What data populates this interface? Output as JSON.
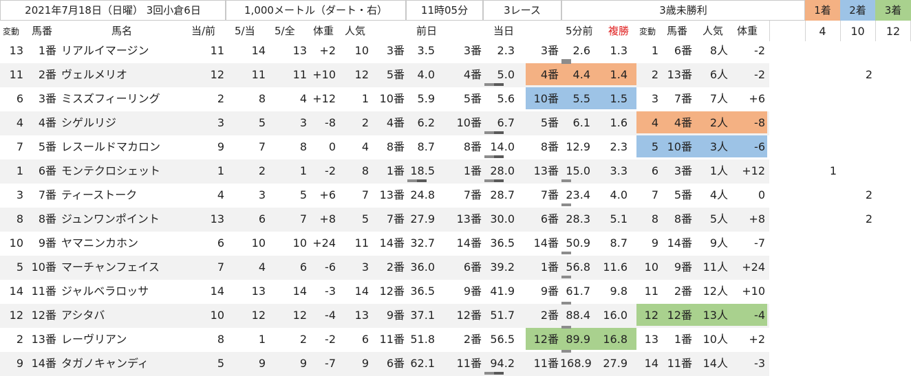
{
  "header": {
    "date": "2021年7月18日（日曜）",
    "meeting": "3回小倉6日",
    "distance": "1,000メートル（ダート・右）",
    "time": "11時05分",
    "race_no": "3レース",
    "race_name": "3歳未勝利",
    "place_labels": [
      "1着",
      "2着",
      "3着"
    ],
    "place_horses": [
      "4",
      "10",
      "12"
    ]
  },
  "columns": {
    "hendo": "変動",
    "umaban": "馬番",
    "bamei": "馬名",
    "ato_mae": "当/前",
    "go_ato": "5/当",
    "go_zen": "5/全",
    "taiju": "体重",
    "ninki": "人気",
    "zenjitsu": "前日",
    "toujitsu": "当日",
    "gofunmae": "5分前",
    "fukusho": "複勝",
    "hendo2": "変動",
    "umaban2": "馬番",
    "ninki2": "人気",
    "taiju2": "体重"
  },
  "colors": {
    "first": "#f4b183",
    "second": "#9dc3e6",
    "third": "#a9d18e",
    "stripe": "#f2f2f2",
    "fukusho_red": "#e02020",
    "marker_dark": "#595959",
    "marker_light": "#8c8c8c"
  },
  "rows": [
    {
      "hendo": "13",
      "umaban": "1番",
      "name": "リアルイマージン",
      "ato_mae": "11",
      "go_ato": "14",
      "go_zen": "13",
      "taiju": "+2",
      "ninki": "10",
      "z_ban": "3番",
      "z_odds": "3.5",
      "t_ban": "3番",
      "t_odds": "2.3",
      "g_ban": "3番",
      "g_odds": "2.6",
      "fuku": "1.3",
      "r_hendo": "1",
      "r_ban": "6番",
      "r_ninki": "8人",
      "r_taiju": "-2",
      "pick": ""
    },
    {
      "hendo": "11",
      "umaban": "2番",
      "name": "ヴェルメリオ",
      "ato_mae": "12",
      "go_ato": "11",
      "go_zen": "11",
      "taiju": "+10",
      "ninki": "12",
      "z_ban": "5番",
      "z_odds": "4.0",
      "t_ban": "4番",
      "t_odds": "5.0",
      "g_ban": "4番",
      "g_odds": "4.4",
      "fuku": "1.4",
      "r_hendo": "2",
      "r_ban": "13番",
      "r_ninki": "6人",
      "r_taiju": "-2",
      "pick": "2"
    },
    {
      "hendo": "6",
      "umaban": "3番",
      "name": "ミスズフィーリング",
      "ato_mae": "2",
      "go_ato": "8",
      "go_zen": "4",
      "taiju": "+12",
      "ninki": "1",
      "z_ban": "10番",
      "z_odds": "5.9",
      "t_ban": "5番",
      "t_odds": "5.6",
      "g_ban": "10番",
      "g_odds": "5.5",
      "fuku": "1.5",
      "r_hendo": "3",
      "r_ban": "7番",
      "r_ninki": "7人",
      "r_taiju": "+6",
      "pick": ""
    },
    {
      "hendo": "4",
      "umaban": "4番",
      "name": "シゲルリジ",
      "ato_mae": "3",
      "go_ato": "5",
      "go_zen": "3",
      "taiju": "-8",
      "ninki": "2",
      "z_ban": "4番",
      "z_odds": "6.2",
      "t_ban": "10番",
      "t_odds": "6.7",
      "g_ban": "5番",
      "g_odds": "6.1",
      "fuku": "1.6",
      "r_hendo": "4",
      "r_ban": "4番",
      "r_ninki": "2人",
      "r_taiju": "-8",
      "pick": ""
    },
    {
      "hendo": "7",
      "umaban": "5番",
      "name": "レスールドマカロン",
      "ato_mae": "9",
      "go_ato": "7",
      "go_zen": "8",
      "taiju": "0",
      "ninki": "4",
      "z_ban": "8番",
      "z_odds": "8.7",
      "t_ban": "8番",
      "t_odds": "14.0",
      "g_ban": "8番",
      "g_odds": "12.9",
      "fuku": "2.3",
      "r_hendo": "5",
      "r_ban": "10番",
      "r_ninki": "3人",
      "r_taiju": "-6",
      "pick": ""
    },
    {
      "hendo": "1",
      "umaban": "6番",
      "name": "モンテクロシェット",
      "ato_mae": "1",
      "go_ato": "2",
      "go_zen": "1",
      "taiju": "-2",
      "ninki": "8",
      "z_ban": "1番",
      "z_odds": "18.5",
      "t_ban": "1番",
      "t_odds": "28.0",
      "g_ban": "13番",
      "g_odds": "15.0",
      "fuku": "3.3",
      "r_hendo": "6",
      "r_ban": "3番",
      "r_ninki": "1人",
      "r_taiju": "+12",
      "pick": "1"
    },
    {
      "hendo": "3",
      "umaban": "7番",
      "name": "ティーストーク",
      "ato_mae": "4",
      "go_ato": "3",
      "go_zen": "5",
      "taiju": "+6",
      "ninki": "7",
      "z_ban": "13番",
      "z_odds": "24.8",
      "t_ban": "7番",
      "t_odds": "28.7",
      "g_ban": "7番",
      "g_odds": "23.4",
      "fuku": "4.0",
      "r_hendo": "7",
      "r_ban": "5番",
      "r_ninki": "4人",
      "r_taiju": "0",
      "pick": "2"
    },
    {
      "hendo": "8",
      "umaban": "8番",
      "name": "ジュンワンポイント",
      "ato_mae": "13",
      "go_ato": "6",
      "go_zen": "7",
      "taiju": "+8",
      "ninki": "5",
      "z_ban": "7番",
      "z_odds": "27.9",
      "t_ban": "13番",
      "t_odds": "30.0",
      "g_ban": "6番",
      "g_odds": "28.3",
      "fuku": "5.1",
      "r_hendo": "8",
      "r_ban": "8番",
      "r_ninki": "5人",
      "r_taiju": "+8",
      "pick": "2"
    },
    {
      "hendo": "10",
      "umaban": "9番",
      "name": "ヤマニンカホン",
      "ato_mae": "6",
      "go_ato": "10",
      "go_zen": "10",
      "taiju": "+24",
      "ninki": "11",
      "z_ban": "14番",
      "z_odds": "32.7",
      "t_ban": "14番",
      "t_odds": "36.5",
      "g_ban": "14番",
      "g_odds": "50.9",
      "fuku": "8.7",
      "r_hendo": "9",
      "r_ban": "14番",
      "r_ninki": "9人",
      "r_taiju": "-7",
      "pick": ""
    },
    {
      "hendo": "5",
      "umaban": "10番",
      "name": "マーチャンフェイス",
      "ato_mae": "7",
      "go_ato": "4",
      "go_zen": "6",
      "taiju": "-6",
      "ninki": "3",
      "z_ban": "2番",
      "z_odds": "36.0",
      "t_ban": "6番",
      "t_odds": "39.2",
      "g_ban": "1番",
      "g_odds": "56.8",
      "fuku": "11.6",
      "r_hendo": "10",
      "r_ban": "9番",
      "r_ninki": "11人",
      "r_taiju": "+24",
      "pick": ""
    },
    {
      "hendo": "14",
      "umaban": "11番",
      "name": "ジャルベラロッサ",
      "ato_mae": "14",
      "go_ato": "13",
      "go_zen": "14",
      "taiju": "-3",
      "ninki": "14",
      "z_ban": "12番",
      "z_odds": "36.5",
      "t_ban": "9番",
      "t_odds": "41.9",
      "g_ban": "9番",
      "g_odds": "61.7",
      "fuku": "9.8",
      "r_hendo": "11",
      "r_ban": "2番",
      "r_ninki": "12人",
      "r_taiju": "+10",
      "pick": ""
    },
    {
      "hendo": "12",
      "umaban": "12番",
      "name": "アシタバ",
      "ato_mae": "10",
      "go_ato": "12",
      "go_zen": "12",
      "taiju": "-4",
      "ninki": "13",
      "z_ban": "9番",
      "z_odds": "37.1",
      "t_ban": "12番",
      "t_odds": "51.7",
      "g_ban": "2番",
      "g_odds": "88.4",
      "fuku": "16.0",
      "r_hendo": "12",
      "r_ban": "12番",
      "r_ninki": "13人",
      "r_taiju": "-4",
      "pick": ""
    },
    {
      "hendo": "2",
      "umaban": "13番",
      "name": "レーヴリアン",
      "ato_mae": "8",
      "go_ato": "1",
      "go_zen": "2",
      "taiju": "-2",
      "ninki": "6",
      "z_ban": "11番",
      "z_odds": "51.8",
      "t_ban": "2番",
      "t_odds": "56.5",
      "g_ban": "12番",
      "g_odds": "89.9",
      "fuku": "16.8",
      "r_hendo": "13",
      "r_ban": "1番",
      "r_ninki": "10人",
      "r_taiju": "+2",
      "pick": ""
    },
    {
      "hendo": "9",
      "umaban": "14番",
      "name": "タガノキャンディ",
      "ato_mae": "5",
      "go_ato": "9",
      "go_zen": "9",
      "taiju": "-7",
      "ninki": "9",
      "z_ban": "6番",
      "z_odds": "62.1",
      "t_ban": "11番",
      "t_odds": "94.2",
      "g_ban": "11番",
      "g_odds": "168.9",
      "fuku": "27.9",
      "r_hendo": "14",
      "r_ban": "11番",
      "r_ninki": "14人",
      "r_taiju": "-3",
      "pick": ""
    }
  ]
}
